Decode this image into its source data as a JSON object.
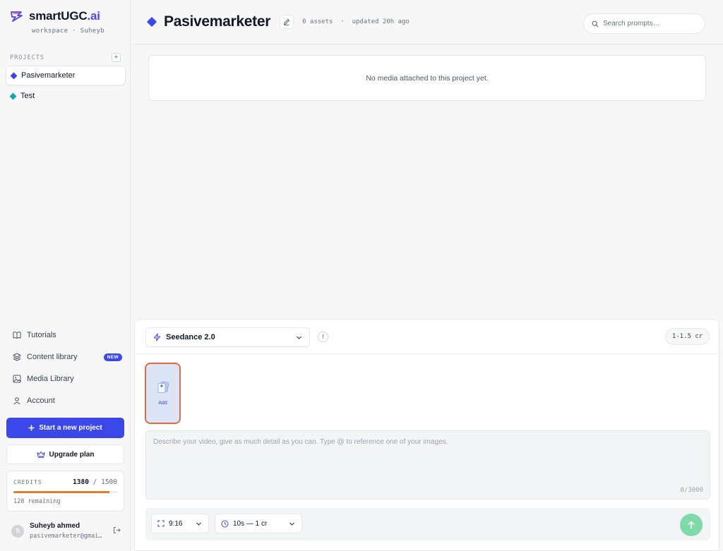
{
  "brand": {
    "name": "smartUGC",
    "suffix": ".ai",
    "workspace": "workspace · Suheyb"
  },
  "sidebar": {
    "projects_label": "PROJECTS",
    "add_project_symbol": "+",
    "projects": [
      {
        "label": "Pasivemarketer",
        "color": "#3b47e8",
        "active": true
      },
      {
        "label": "Test",
        "color": "#0ea5b7",
        "active": false
      }
    ],
    "nav": [
      {
        "label": "Tutorials",
        "icon": "book-icon"
      },
      {
        "label": "Content library",
        "icon": "layers-icon",
        "badge": "NEW"
      },
      {
        "label": "Media Library",
        "icon": "image-icon"
      },
      {
        "label": "Account",
        "icon": "user-icon"
      }
    ],
    "start_project_label": "Start a new project",
    "upgrade_label": "Upgrade plan",
    "credits": {
      "label": "CREDITS",
      "used": "1380",
      "separator": " / ",
      "total": "1500",
      "remaining": "120 remaining",
      "fill_fraction": 0.92
    },
    "user": {
      "initial": "S",
      "name": "Suheyb ahmed",
      "email": "pasivemarketer@gmai…"
    }
  },
  "header": {
    "title": "Pasivemarketer",
    "assets": "0 assets",
    "separator": "·",
    "updated": "updated 20h ago",
    "search_placeholder": "Search prompts…"
  },
  "media": {
    "empty_text": "No media attached to this project yet."
  },
  "composer": {
    "model": "Seedance 2.0",
    "info_symbol": "!",
    "cost": "1-1.5 cr",
    "add_label": "Add",
    "prompt_placeholder": "Describe your video, give as much detail as you can. Type @ to reference one of your images.",
    "counter": "0/3000",
    "aspect": "9:16",
    "duration": "10s — 1 cr"
  },
  "colors": {
    "accent": "#3b47e8",
    "highlight": "#e46a3c",
    "send": "#7fdaa8",
    "progress": "#e07b2a"
  }
}
